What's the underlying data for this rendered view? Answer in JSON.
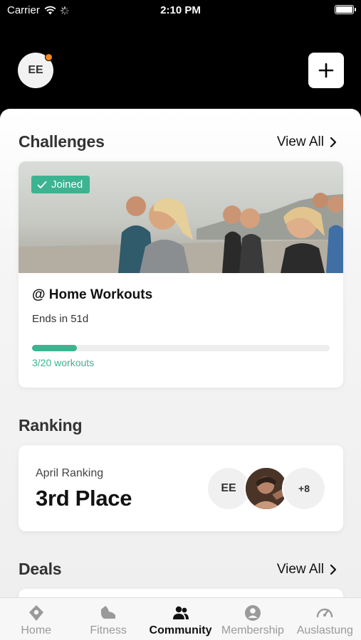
{
  "status_bar": {
    "carrier": "Carrier",
    "time": "2:10 PM"
  },
  "header": {
    "avatar_initials": "EE"
  },
  "challenges": {
    "title": "Challenges",
    "view_all": "View All",
    "card": {
      "badge": "Joined",
      "name": "@ Home Workouts",
      "ends": "Ends in 51d",
      "progress_text": "3/20 workouts",
      "progress_completed": 3,
      "progress_total": 20
    }
  },
  "ranking": {
    "title": "Ranking",
    "label": "April Ranking",
    "place": "3rd Place",
    "avatars": {
      "first_initials": "EE",
      "more_count": "+8"
    }
  },
  "deals": {
    "title": "Deals",
    "view_all": "View All"
  },
  "tab_bar": {
    "items": [
      {
        "label": "Home",
        "icon": "location-pin-icon",
        "active": false
      },
      {
        "label": "Fitness",
        "icon": "shoe-icon",
        "active": false
      },
      {
        "label": "Community",
        "icon": "people-icon",
        "active": true
      },
      {
        "label": "Membership",
        "icon": "person-circle-icon",
        "active": false
      },
      {
        "label": "Auslastung",
        "icon": "gauge-icon",
        "active": false
      }
    ]
  },
  "colors": {
    "accent": "#3db391",
    "notification": "#f5891f",
    "header_bg": "#000000"
  }
}
